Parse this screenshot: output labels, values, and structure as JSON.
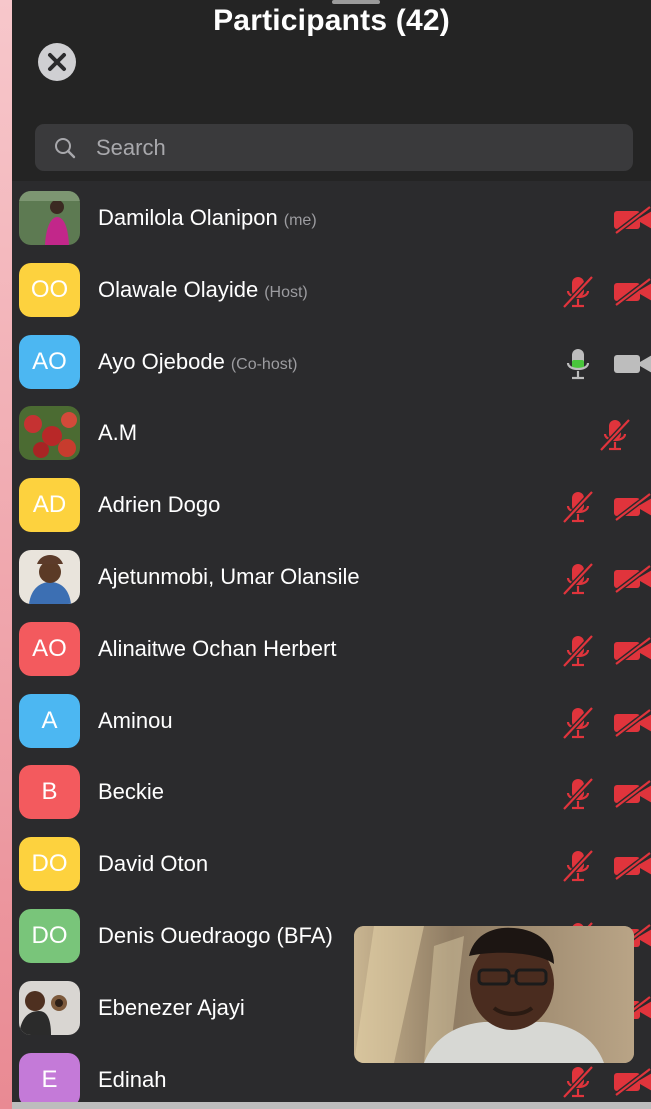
{
  "header": {
    "title": "Participants (42)",
    "close_icon": "close-icon"
  },
  "search": {
    "placeholder": "Search",
    "icon": "search-icon"
  },
  "colors": {
    "panel_bg": "#2b2b2d",
    "muted_red": "#e0343c",
    "mic_on_green": "#49c53b",
    "avatar_yellow": "#fdd23e",
    "avatar_blue": "#4cb7f2",
    "avatar_red": "#f35a5e",
    "avatar_green": "#79c57a",
    "avatar_purple": "#c47ad8"
  },
  "participants": [
    {
      "name": "Damilola Olanipon",
      "tag": "(me)",
      "avatar": "photo",
      "audio": "none",
      "video": "off"
    },
    {
      "name": "Olawale Olayide",
      "tag": "(Host)",
      "avatar": "OO",
      "audio": "muted",
      "video": "off"
    },
    {
      "name": "Ayo Ojebode",
      "tag": "(Co-host)",
      "avatar": "AO",
      "audio": "on",
      "video": "on"
    },
    {
      "name": "A.M",
      "tag": "",
      "avatar": "photo",
      "audio": "muted",
      "video": "none"
    },
    {
      "name": "Adrien Dogo",
      "tag": "",
      "avatar": "AD",
      "audio": "muted",
      "video": "off"
    },
    {
      "name": "Ajetunmobi, Umar Olansile",
      "tag": "",
      "avatar": "photo",
      "audio": "muted",
      "video": "off"
    },
    {
      "name": "Alinaitwe Ochan Herbert",
      "tag": "",
      "avatar": "AO",
      "audio": "muted",
      "video": "off"
    },
    {
      "name": "Aminou",
      "tag": "",
      "avatar": "A",
      "audio": "muted",
      "video": "off"
    },
    {
      "name": "Beckie",
      "tag": "",
      "avatar": "B",
      "audio": "muted",
      "video": "off"
    },
    {
      "name": "David Oton",
      "tag": "",
      "avatar": "DO",
      "audio": "muted",
      "video": "off"
    },
    {
      "name": "Denis Ouedraogo (BFA)",
      "tag": "",
      "avatar": "DO",
      "audio": "muted",
      "video": "off"
    },
    {
      "name": "Ebenezer Ajayi",
      "tag": "",
      "avatar": "photo",
      "audio": "muted",
      "video": "off"
    },
    {
      "name": "Edinah",
      "tag": "",
      "avatar": "E",
      "audio": "muted",
      "video": "off"
    }
  ],
  "self_view": {
    "icon": "self-video-thumbnail"
  }
}
